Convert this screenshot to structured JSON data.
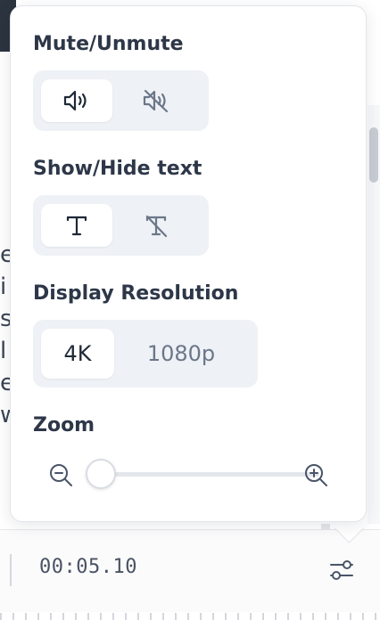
{
  "popover": {
    "mute": {
      "title": "Mute/Unmute",
      "options": [
        {
          "icon": "speaker-on-icon",
          "active": true
        },
        {
          "icon": "speaker-off-icon",
          "active": false
        }
      ]
    },
    "text_toggle": {
      "title": "Show/Hide text",
      "options": [
        {
          "icon": "text-icon",
          "active": true
        },
        {
          "icon": "text-off-icon",
          "active": false
        }
      ]
    },
    "resolution": {
      "title": "Display Resolution",
      "options": [
        {
          "label": "4K",
          "active": true
        },
        {
          "label": "1080p",
          "active": false
        }
      ]
    },
    "zoom": {
      "title": "Zoom",
      "level": 0.05
    }
  },
  "player": {
    "timecode": "00:05.10",
    "settings_icon": "sliders-icon"
  },
  "background": {
    "partial_letters": [
      "e",
      "i",
      "s",
      "l",
      "e",
      "w"
    ]
  },
  "colors": {
    "segment_bg": "#eef1f5",
    "text_dark": "#2d3748",
    "icon_muted": "#6b7789"
  }
}
